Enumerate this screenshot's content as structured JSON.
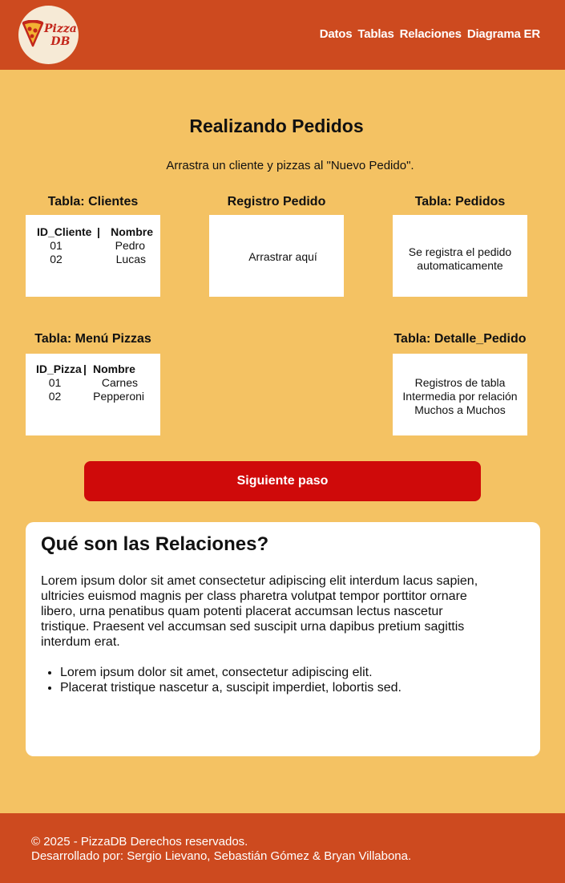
{
  "header": {
    "logo": {
      "line1": "Pizza",
      "line2": "DB",
      "icon": "pizza-slice-icon"
    },
    "nav": [
      "Datos",
      "Tablas",
      "Relaciones",
      "Diagrama ER"
    ]
  },
  "main": {
    "title": "Realizando Pedidos",
    "subtitle": "Arrastra un cliente y pizzas al \"Nuevo Pedido\".",
    "clientes": {
      "label": "Tabla: Clientes",
      "headers": [
        "ID_Cliente",
        "Nombre"
      ],
      "rows": [
        [
          "01",
          "Pedro"
        ],
        [
          "02",
          "Lucas"
        ]
      ]
    },
    "registro": {
      "label": "Registro Pedido",
      "placeholder": "Arrastrar aquí"
    },
    "pedidos": {
      "label": "Tabla: Pedidos",
      "line1": "Se registra el pedido",
      "line2": "automaticamente"
    },
    "menu": {
      "label": "Tabla: Menú Pizzas",
      "headers": [
        "ID_Pizza",
        "Nombre"
      ],
      "rows": [
        [
          "01",
          "Carnes"
        ],
        [
          "02",
          "Pepperoni"
        ]
      ]
    },
    "detalle": {
      "label": "Tabla: Detalle_Pedido",
      "line1": "Registros de tabla",
      "line2": "Intermedia por relación",
      "line3": "Muchos a Muchos"
    },
    "next_button": "Siguiente paso"
  },
  "info": {
    "title": "Qué son las Relaciones?",
    "paragraph": "Lorem ipsum dolor sit amet consectetur adipiscing elit interdum lacus sapien, ultricies euismod magnis per class pharetra volutpat tempor porttitor ornare libero, urna penatibus quam potenti placerat accumsan lectus nascetur tristique. Praesent vel accumsan sed suscipit urna dapibus pretium sagittis interdum erat.",
    "bullets": [
      "Lorem ipsum dolor sit amet, consectetur adipiscing elit.",
      "Placerat tristique nascetur a, suscipit imperdiet, lobortis sed."
    ]
  },
  "footer": {
    "line1": "© 2025 - PizzaDB Derechos reservados.",
    "line2": "Desarrollado por: Sergio Lievano, Sebastián Gómez & Bryan Villabona."
  },
  "colors": {
    "header_bg": "#cd4a1f",
    "page_bg": "#f4c263",
    "button_bg": "#cf0a0a",
    "logo_bg": "#f6ead6"
  }
}
